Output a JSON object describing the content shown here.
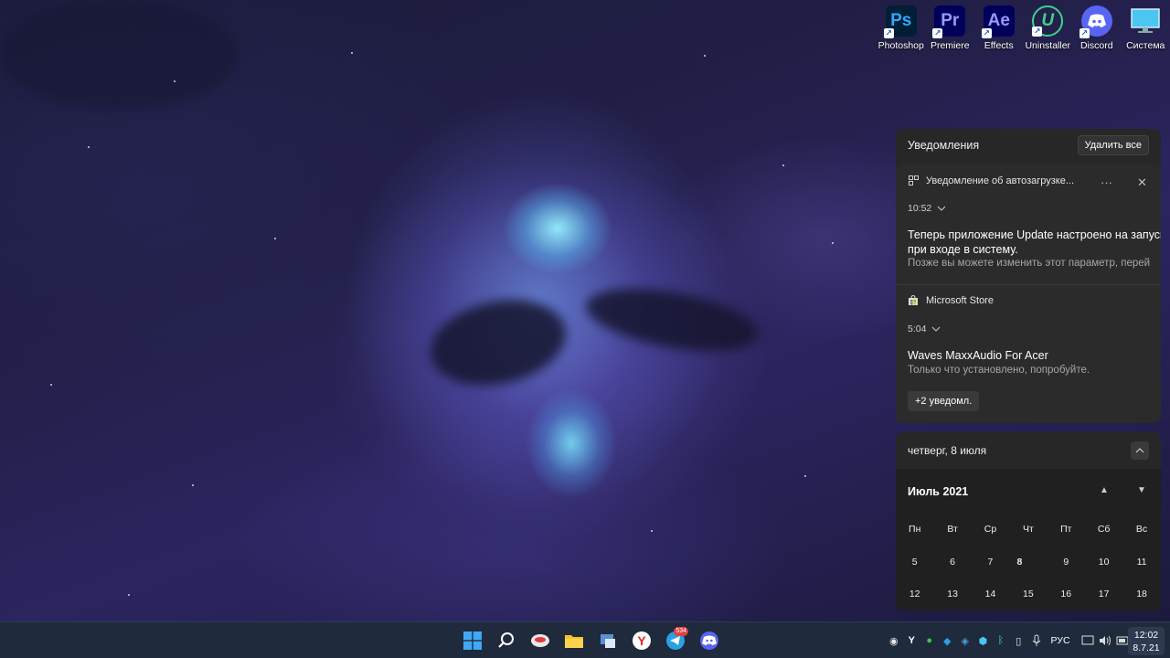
{
  "desktop_icons": [
    {
      "label": "Photoshop",
      "icon": "photoshop-icon",
      "glyph": "Ps",
      "color": "#001e36",
      "fg": "#31a8ff"
    },
    {
      "label": "Premiere",
      "icon": "premiere-icon",
      "glyph": "Pr",
      "color": "#00005b",
      "fg": "#9999ff"
    },
    {
      "label": "Effects",
      "icon": "after-effects-icon",
      "glyph": "Ae",
      "color": "#00005b",
      "fg": "#9999ff"
    },
    {
      "label": "Uninstaller",
      "icon": "uninstaller-icon",
      "glyph": "U",
      "color": "transparent",
      "fg": "#3cd38a"
    },
    {
      "label": "Discord",
      "icon": "discord-icon",
      "glyph": "",
      "color": "#5865f2",
      "fg": "#ffffff"
    },
    {
      "label": "Система",
      "icon": "system-monitor-icon",
      "glyph": "",
      "color": "transparent",
      "fg": "#4ac6f0"
    }
  ],
  "notifications": {
    "header": "Уведомления",
    "clear_all": "Удалить все",
    "items": [
      {
        "app": "Уведомление об автозагрузке...",
        "time": "10:52",
        "title_line1": "Теперь приложение Update настроено на запуск",
        "title_line2": "при входе в систему.",
        "body": "Позже вы можете изменить этот параметр, перей"
      },
      {
        "app": "Microsoft Store",
        "time": "5:04",
        "title_line1": "Waves MaxxAudio For Acer",
        "body": "Только что установлено, попробуйте.",
        "more": "+2 уведомл."
      }
    ]
  },
  "calendar": {
    "date_label": "четверг, 8 июля",
    "month_label": "Июль 2021",
    "weekdays": [
      "Пн",
      "Вт",
      "Ср",
      "Чт",
      "Пт",
      "Сб",
      "Вс"
    ],
    "week1": [
      "5",
      "6",
      "7",
      "8",
      "9",
      "10",
      "11"
    ],
    "week2": [
      "12",
      "13",
      "14",
      "15",
      "16",
      "17",
      "18"
    ],
    "today": "8",
    "today_color": "#d3a4e2"
  },
  "taskbar": {
    "telegram_badge": "534",
    "language": "РУС",
    "time": "12:02",
    "date": "8.7.21"
  }
}
